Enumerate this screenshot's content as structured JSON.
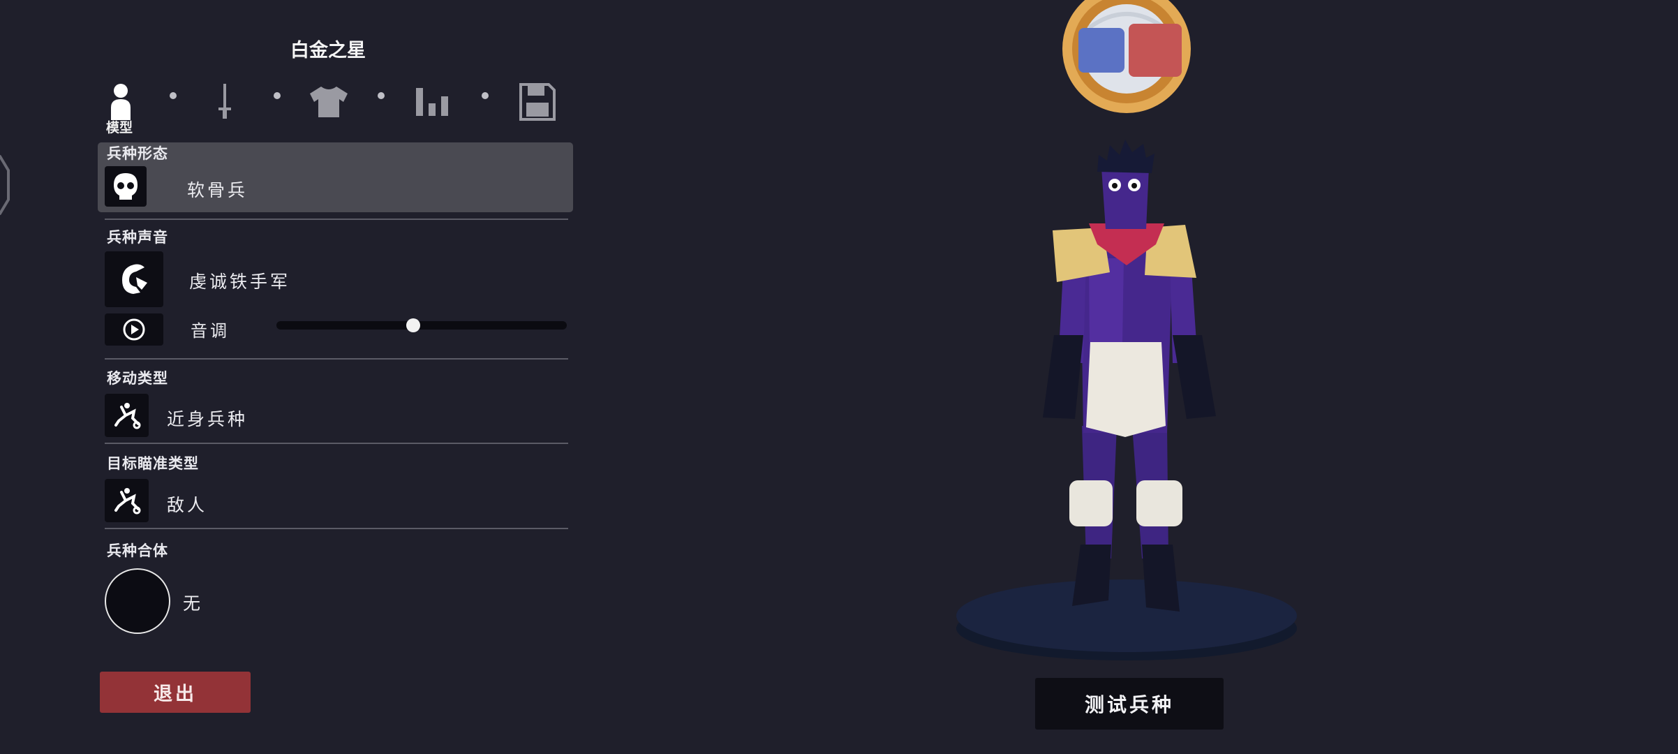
{
  "unit": {
    "name": "白金之星"
  },
  "tabs": [
    {
      "icon": "person-icon",
      "label": "模型"
    },
    {
      "icon": "sword-icon"
    },
    {
      "icon": "shirt-icon"
    },
    {
      "icon": "stats-icon"
    },
    {
      "icon": "save-icon"
    }
  ],
  "sections": {
    "form": {
      "label": "兵种形态",
      "value": "软骨兵",
      "icon": "skull-icon"
    },
    "voice": {
      "label": "兵种声音",
      "value": "虔诚铁手军",
      "icon": "voice-icon",
      "pitch_label": "音调",
      "pitch_level": 0.47
    },
    "movement": {
      "label": "移动类型",
      "value": "近身兵种",
      "icon": "melee-icon"
    },
    "targeting": {
      "label": "目标瞄准类型",
      "value": "敌人",
      "icon": "target-icon"
    },
    "combo": {
      "label": "兵种合体",
      "value": "无"
    }
  },
  "buttons": {
    "exit": "退出",
    "test": "测试兵种"
  },
  "colors": {
    "background": "#1f1f2b",
    "selected_row": "#4a4a52",
    "exit_button": "#933337",
    "team_blue": "#5b72c4",
    "team_red": "#c45555"
  }
}
